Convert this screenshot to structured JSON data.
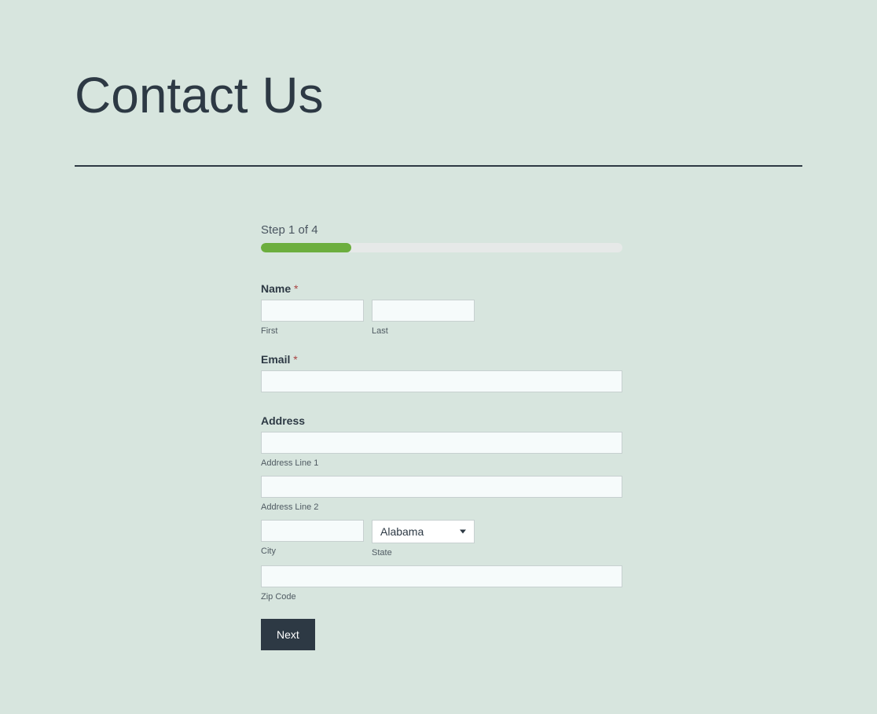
{
  "page": {
    "title": "Contact Us"
  },
  "form": {
    "step_label": "Step 1 of 4",
    "progress_percent": 25,
    "name": {
      "label": "Name",
      "required_mark": "*",
      "first_sub": "First",
      "last_sub": "Last",
      "first_value": "",
      "last_value": ""
    },
    "email": {
      "label": "Email",
      "required_mark": "*",
      "value": ""
    },
    "address": {
      "label": "Address",
      "line1_sub": "Address Line 1",
      "line2_sub": "Address Line 2",
      "city_sub": "City",
      "state_sub": "State",
      "zip_sub": "Zip Code",
      "line1_value": "",
      "line2_value": "",
      "city_value": "",
      "state_selected": "Alabama",
      "zip_value": ""
    },
    "next_label": "Next"
  }
}
